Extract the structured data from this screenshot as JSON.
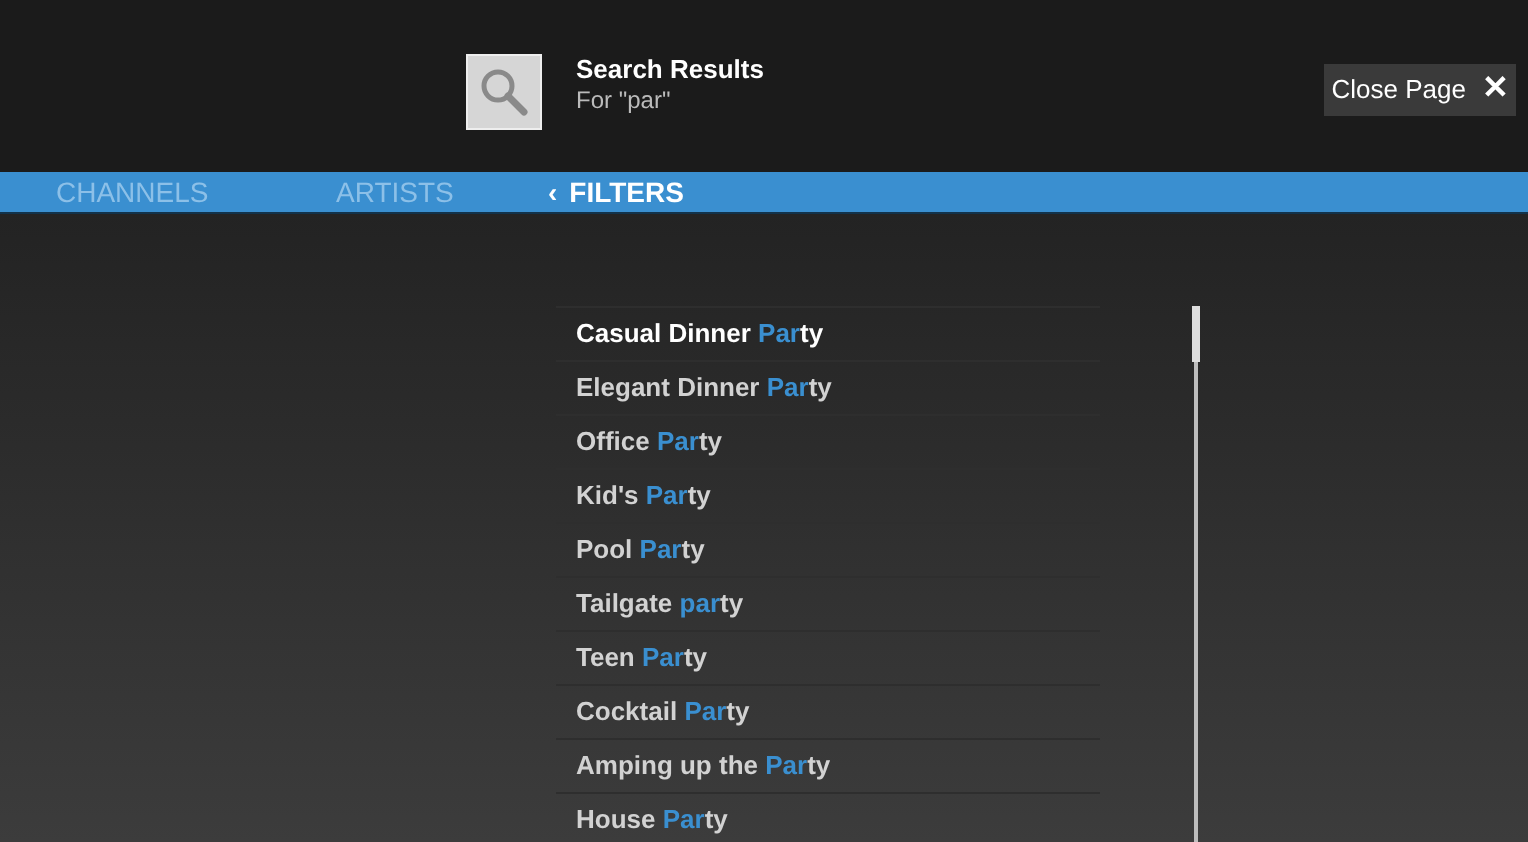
{
  "header": {
    "title": "Search Results",
    "subtitle": "For \"par\"",
    "close_button": {
      "label": "Close Page",
      "icon": "✕"
    }
  },
  "tabs": [
    {
      "label": "CHANNELS",
      "selected": false
    },
    {
      "label": "ARTISTS",
      "selected": false
    },
    {
      "label": "FILTERS",
      "selected": true,
      "chevron": "‹"
    }
  ],
  "results": [
    {
      "before": "Casual Dinner ",
      "match": "Par",
      "after": "ty",
      "selected": true
    },
    {
      "before": "Elegant Dinner ",
      "match": "Par",
      "after": "ty",
      "selected": false
    },
    {
      "before": "Office ",
      "match": "Par",
      "after": "ty",
      "selected": false
    },
    {
      "before": "Kid's ",
      "match": "Par",
      "after": "ty",
      "selected": false
    },
    {
      "before": "Pool ",
      "match": "Par",
      "after": "ty",
      "selected": false
    },
    {
      "before": "Tailgate ",
      "match": "par",
      "after": "ty",
      "selected": false
    },
    {
      "before": "Teen ",
      "match": "Par",
      "after": "ty",
      "selected": false
    },
    {
      "before": "Cocktail ",
      "match": "Par",
      "after": "ty",
      "selected": false
    },
    {
      "before": "Amping up the ",
      "match": "Par",
      "after": "ty",
      "selected": false
    },
    {
      "before": "House ",
      "match": "Par",
      "after": "ty",
      "selected": false
    }
  ]
}
